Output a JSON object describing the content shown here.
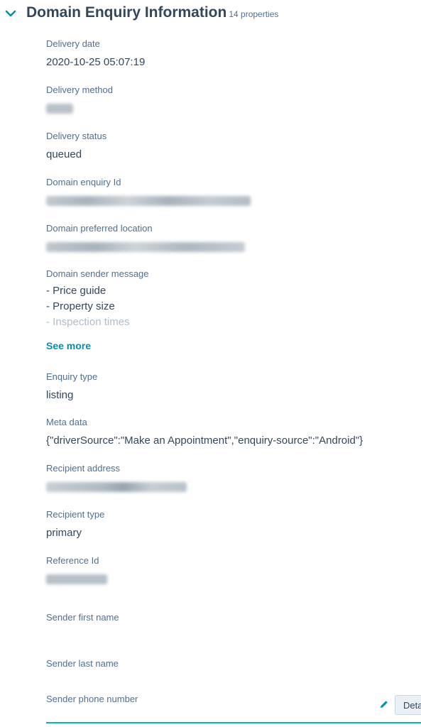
{
  "section": {
    "title": "Domain Enquiry Information",
    "count": "14 properties"
  },
  "properties": {
    "delivery_date": {
      "label": "Delivery date",
      "value": "2020-10-25 05:07:19"
    },
    "delivery_method": {
      "label": "Delivery method"
    },
    "delivery_status": {
      "label": "Delivery status",
      "value": "queued"
    },
    "domain_enquiry_id": {
      "label": "Domain enquiry Id"
    },
    "domain_preferred_location": {
      "label": "Domain preferred location"
    },
    "domain_sender_message": {
      "label": "Domain sender message",
      "lines": [
        "- Price guide",
        "- Property size",
        "- Inspection times"
      ],
      "see_more": "See more"
    },
    "enquiry_type": {
      "label": "Enquiry type",
      "value": "listing"
    },
    "meta_data": {
      "label": "Meta data",
      "value": "{\"driverSource\":\"Make an Appointment\",\"enquiry-source\":\"Android\"}"
    },
    "recipient_address": {
      "label": "Recipient address"
    },
    "recipient_type": {
      "label": "Recipient type",
      "value": "primary"
    },
    "reference_id": {
      "label": "Reference Id"
    },
    "sender_first_name": {
      "label": "Sender first name"
    },
    "sender_last_name": {
      "label": "Sender last name"
    },
    "sender_phone_number": {
      "label": "Sender phone number"
    }
  },
  "actions": {
    "details_label": "Details"
  },
  "icons": {
    "collapse": "chevron-down-icon",
    "edit": "pencil-icon"
  },
  "colors": {
    "text": "#33475b",
    "label": "#516f90",
    "link": "#0091ae",
    "focus": "#00bda5"
  }
}
